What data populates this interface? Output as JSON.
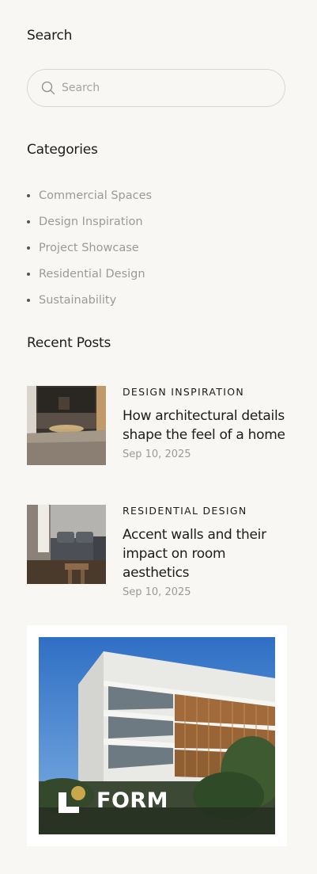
{
  "search": {
    "heading": "Search",
    "placeholder": "Search"
  },
  "categories": {
    "heading": "Categories",
    "items": [
      "Commercial Spaces",
      "Design Inspiration",
      "Project Showcase",
      "Residential Design",
      "Sustainability"
    ]
  },
  "recent_posts": {
    "heading": "Recent Posts",
    "posts": [
      {
        "category": "DESIGN INSPIRATION",
        "title": "How architectural details shape the feel of a home",
        "date": "Sep 10, 2025",
        "thumb_icon": "kitchen-photo"
      },
      {
        "category": "RESIDENTIAL DESIGN",
        "title": "Accent walls and their impact on room aesthetics",
        "date": "Sep 10, 2025",
        "thumb_icon": "living-room-photo"
      }
    ]
  },
  "ad": {
    "brand": "FORM",
    "logo_icon": "form-logo-icon"
  },
  "colors": {
    "background": "#f8f7f4",
    "text": "#1c1c1c",
    "muted": "#9a9a98",
    "accent_gold": "#c9a84c"
  }
}
